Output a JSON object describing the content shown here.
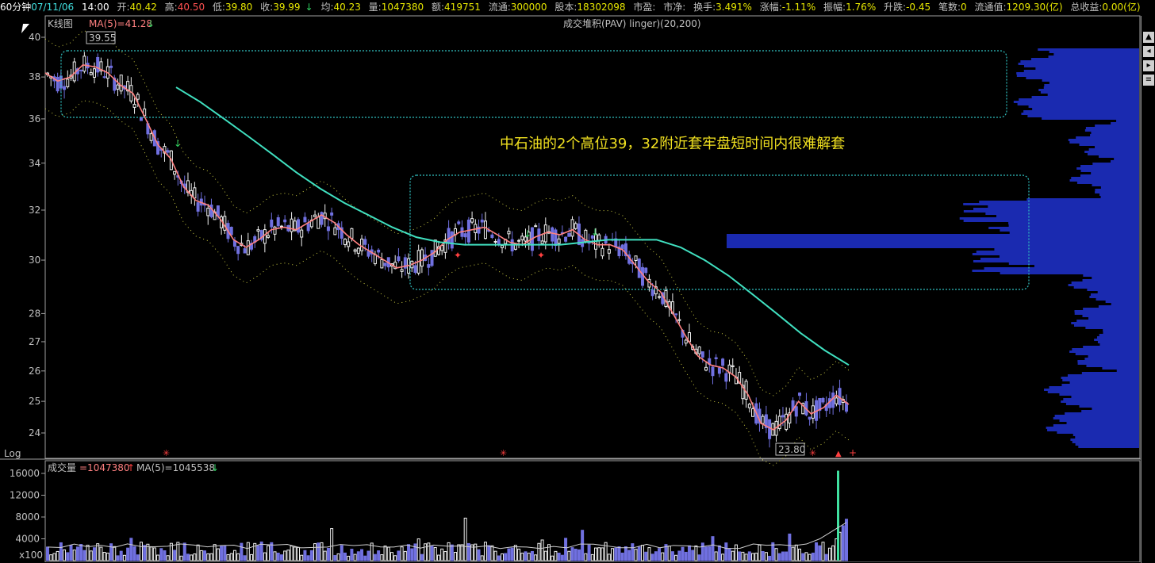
{
  "header": {
    "period": "60分钟",
    "date": "07/11/06",
    "time": "14:00",
    "open_label": "开:",
    "open": "40.42",
    "high_label": "高:",
    "high": "40.50",
    "low_label": "低:",
    "low": "39.80",
    "close_label": "收:",
    "close": "39.99",
    "avg_label": "均:",
    "avg": "40.23",
    "vol_label": "量:",
    "vol": "1047380",
    "amt_label": "额:",
    "amt": "419751",
    "float_label": "流通:",
    "float": "300000",
    "shares_label": "股本:",
    "shares": "18302098",
    "pe_label": "市盈:",
    "pb_label": "市净:",
    "turnover_label": "换手:",
    "turnover": "3.491%",
    "change_pct_label": "涨幅:",
    "change_pct": "-1.11%",
    "amp_label": "振幅:",
    "amp": "1.76%",
    "updown_label": "升跌:",
    "updown": "-0.45",
    "trades_label": "笔数:",
    "trades": "0",
    "float_value_label": "流通值:",
    "float_value": "1209.30(亿)",
    "total_value_label": "总收益:",
    "total_value": "0.00(亿)"
  },
  "main_panel": {
    "chart_type_label": "K线图",
    "ma_label": "MA(5)=41.28",
    "indicator_title": "成交堆积(PAV) linger)(20,200)",
    "scale_label": "Log",
    "high_marker": "39.55",
    "low_marker": "23.80",
    "annotation": "中石油的2个高位39，32附近套牢盘短时间内很难解套"
  },
  "volume_panel": {
    "title": "成交量",
    "vol_value": "=1047380",
    "ma_label": "MA(5)=1045538",
    "unit_label": "x100",
    "y_ticks": [
      "16000",
      "12000",
      "8000",
      "4000"
    ]
  },
  "colors": {
    "up": "#f0f0f0",
    "down": "#7070e0",
    "ma5": "#ff8080",
    "long_ma": "#40e0c0",
    "box": "#30c0c0",
    "profile": "#1a2ab0",
    "annotation": "#f0e020"
  },
  "chart_data": {
    "type": "candlestick",
    "y_scale": "log",
    "y_ticks": [
      40,
      38,
      36,
      34,
      32,
      30,
      28,
      27,
      26,
      25,
      24
    ],
    "price_range": [
      23.5,
      40.5
    ],
    "ma5": [
      38.2,
      37.8,
      38.0,
      38.6,
      38.5,
      38.2,
      37.6,
      37.2,
      36.0,
      34.8,
      34.2,
      33.0,
      32.4,
      32.2,
      31.6,
      30.8,
      30.5,
      30.8,
      31.2,
      31.3,
      31.2,
      31.5,
      31.8,
      31.5,
      31.0,
      30.6,
      30.3,
      30.0,
      29.7,
      29.8,
      30.0,
      30.3,
      30.8,
      31.1,
      31.2,
      31.3,
      31.0,
      30.7,
      30.6,
      30.9,
      31.1,
      31.0,
      31.2,
      30.8,
      30.6,
      30.6,
      30.4,
      29.8,
      29.2,
      28.8,
      28.0,
      27.2,
      26.5,
      26.2,
      26.1,
      25.8,
      25.2,
      24.3,
      24.1,
      24.4,
      25.0,
      24.6,
      24.8,
      25.2,
      24.9
    ],
    "long_ma": [
      37.5,
      36.8,
      36.0,
      35.2,
      34.4,
      33.6,
      32.9,
      32.3,
      31.8,
      31.3,
      30.9,
      30.7,
      30.6,
      30.6,
      30.6,
      30.6,
      30.6,
      30.7,
      30.8,
      30.8,
      30.8,
      30.5,
      30.0,
      29.4,
      28.7,
      28.0,
      27.3,
      26.7,
      26.2
    ],
    "volume_ma5_max": 16000,
    "spike_volume": 16500
  }
}
